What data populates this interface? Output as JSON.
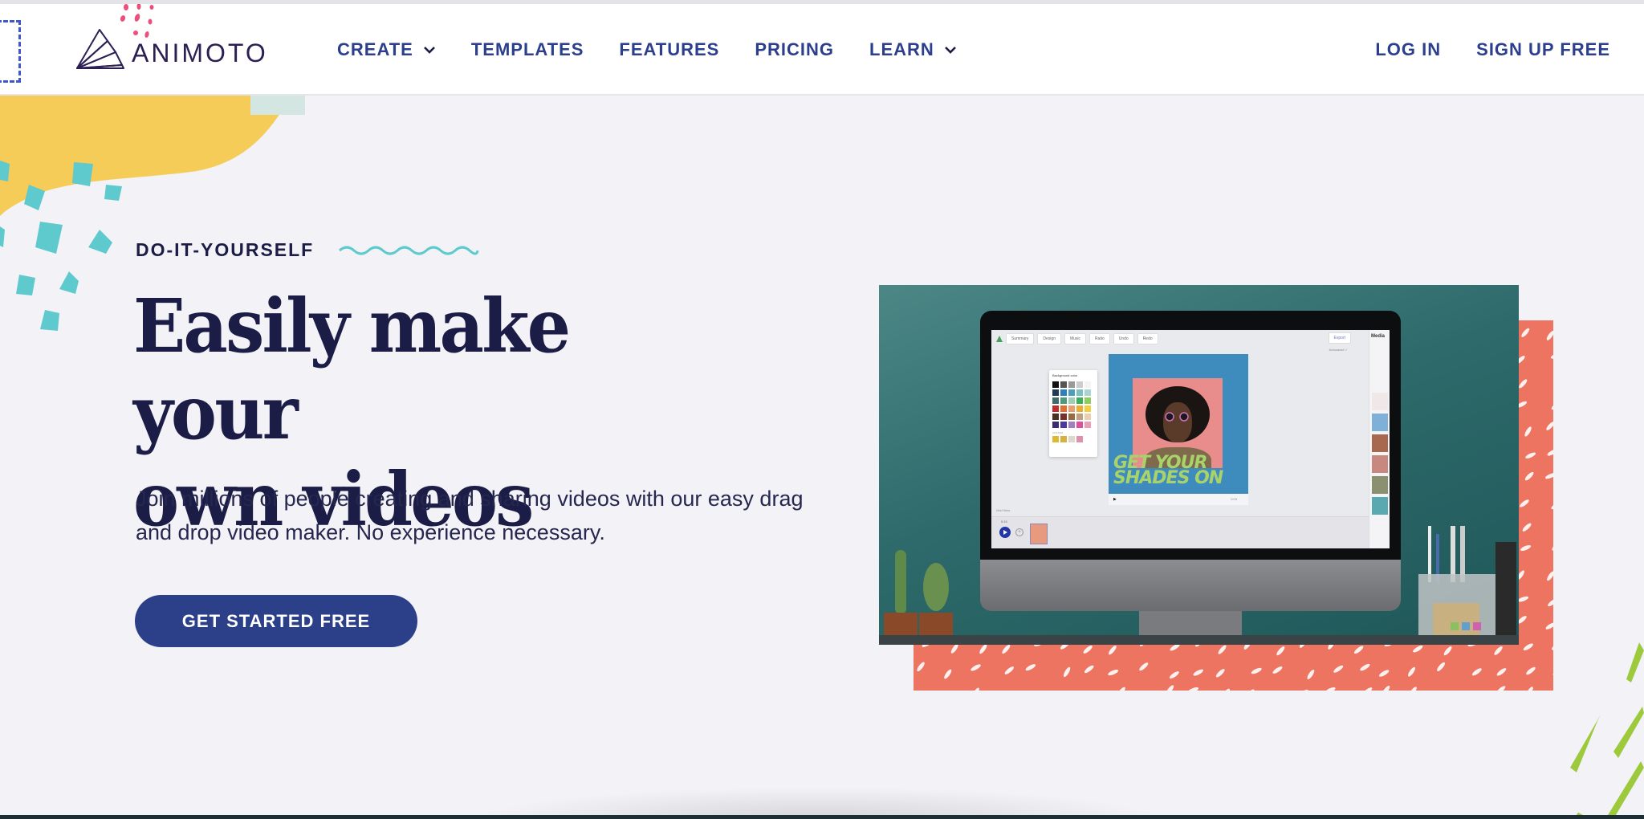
{
  "header": {
    "logo": {
      "text": "ANIMOTO",
      "icon": "animoto-fan-logo-icon"
    },
    "nav": [
      {
        "label": "CREATE",
        "has_dropdown": true
      },
      {
        "label": "TEMPLATES",
        "has_dropdown": false
      },
      {
        "label": "FEATURES",
        "has_dropdown": false
      },
      {
        "label": "PRICING",
        "has_dropdown": false
      },
      {
        "label": "LEARN",
        "has_dropdown": true
      }
    ],
    "auth": {
      "login_label": "LOG IN",
      "signup_label": "SIGN UP FREE"
    }
  },
  "hero": {
    "eyebrow": "DO-IT-YOURSELF",
    "title_line1": "Easily make your",
    "title_line2": "own videos",
    "subtitle": "Join millions of people creating and sharing videos with our easy drag and drop video maker. No experience necessary.",
    "cta_label": "GET STARTED FREE"
  },
  "video_preview": {
    "app_toolbar": [
      "Summary",
      "Design",
      "Music",
      "Ratio",
      "Undo",
      "Redo"
    ],
    "export_label": "Export",
    "autosaved_label": "Autosaved ✓",
    "media_panel_title": "Media",
    "background_color_popup": {
      "title": "Background color",
      "custom_label": "CUSTOM",
      "swatches": [
        "#111111",
        "#555555",
        "#999999",
        "#cccccc",
        "#f4f4f4",
        "#1f3b5a",
        "#2d7fc0",
        "#4aa0b8",
        "#7cc0c2",
        "#a8d4d4",
        "#3f6b6a",
        "#4f9a7a",
        "#9fcfb0",
        "#3bb05a",
        "#8ccf5a",
        "#c42a2a",
        "#e0702a",
        "#e8a070",
        "#e8b030",
        "#f0d040",
        "#4a3020",
        "#7a3028",
        "#9a6a40",
        "#c0a080",
        "#e8d0b0",
        "#3a2a70",
        "#4a3aa0",
        "#a080c0",
        "#e0509a",
        "#e8a0b8"
      ],
      "custom_swatches": [
        "#e0b830",
        "#d8b040",
        "#ddd8c8",
        "#e090a8"
      ]
    },
    "canvas_text_line1": "GET YOUR",
    "canvas_text_line2": "SHADES ON",
    "playbar_time": "0:03",
    "grid_view_label": "Grid View",
    "timeline_time": "0:19"
  },
  "colors": {
    "brand_navy": "#2c3f89",
    "heading": "#1b1d47",
    "page_bg": "#f3f2f7",
    "accent_yellow": "#f6cc58",
    "accent_teal": "#5ecacd",
    "accent_coral": "#ee7462",
    "accent_green": "#9cca3c",
    "accent_pink": "#ec4f7c"
  }
}
